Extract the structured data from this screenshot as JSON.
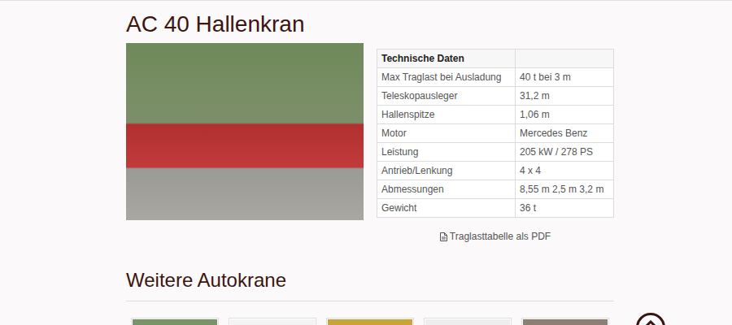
{
  "title": "AC 40 Hallenkran",
  "specs": {
    "header": [
      "Technische Daten",
      ""
    ],
    "rows": [
      [
        "Max Traglast bei Ausladung",
        "40 t bei 3 m"
      ],
      [
        "Teleskopausleger",
        "31,2 m"
      ],
      [
        "Hallenspitze",
        "1,06 m"
      ],
      [
        "Motor",
        "Mercedes Benz"
      ],
      [
        "Leistung",
        "205 kW / 278 PS"
      ],
      [
        "Antrieb/Lenkung",
        "4 x 4"
      ],
      [
        "Abmessungen",
        "8,55 m 2,5 m 3,2 m"
      ],
      [
        "Gewicht",
        "36 t"
      ]
    ]
  },
  "pdf_link": {
    "label": "Traglasttabelle als PDF"
  },
  "more_heading": "Weitere Autokrane"
}
